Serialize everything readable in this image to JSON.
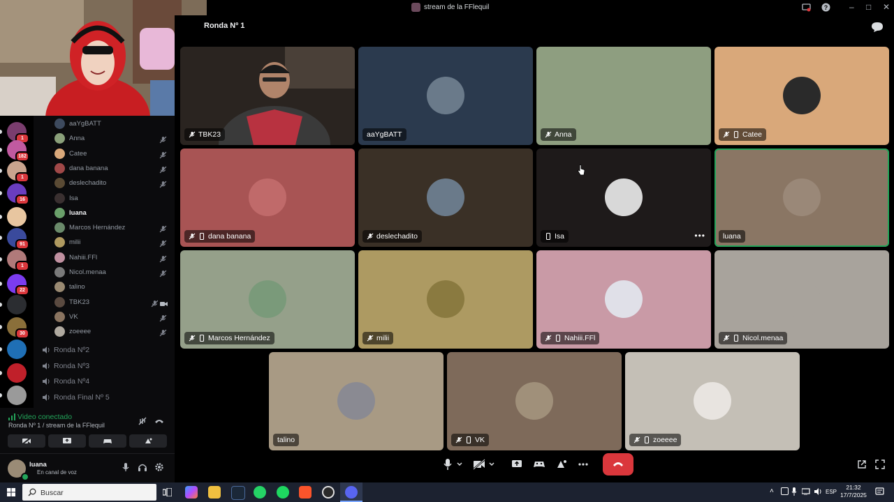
{
  "window": {
    "title": "stream de la FFlequil"
  },
  "stage": {
    "title": "Ronda Nº 1"
  },
  "servers": [
    {
      "badge": "1",
      "color": "#7a3d6e"
    },
    {
      "badge": "182",
      "color": "#c05aa0"
    },
    {
      "badge": "1",
      "color": "#c9a48e"
    },
    {
      "badge": "16",
      "color": "#6a3dbf"
    },
    {
      "badge": "",
      "color": "#e8c6a0"
    },
    {
      "badge": "91",
      "color": "#3a4a9c"
    },
    {
      "badge": "1",
      "color": "#b07a7a"
    },
    {
      "badge": "22",
      "color": "#7b3cf0"
    },
    {
      "badge": "",
      "color": "#2b2d31"
    },
    {
      "badge": "30",
      "color": "#8a6f3a"
    },
    {
      "badge": "",
      "color": "#1f6fb5"
    },
    {
      "badge": "",
      "color": "#c0202a"
    },
    {
      "badge": "",
      "color": "#9a9a9a"
    }
  ],
  "members": [
    {
      "name": "aaYgBATT",
      "muted": false,
      "video": false,
      "color": "#3d4a5e"
    },
    {
      "name": "Anna",
      "muted": true,
      "video": false,
      "color": "#8aa07a"
    },
    {
      "name": "Catee",
      "muted": true,
      "video": false,
      "color": "#d9a87a"
    },
    {
      "name": "dana banana",
      "muted": true,
      "video": false,
      "color": "#a04848"
    },
    {
      "name": "deslechadito",
      "muted": true,
      "video": false,
      "color": "#5a4a34"
    },
    {
      "name": "Isa",
      "muted": false,
      "video": false,
      "color": "#3a3030"
    },
    {
      "name": "luana",
      "muted": false,
      "video": false,
      "color": "#6aa06a"
    },
    {
      "name": "Marcos Hernández",
      "muted": true,
      "video": false,
      "color": "#6a8a6a"
    },
    {
      "name": "milii",
      "muted": true,
      "video": false,
      "color": "#b09a60"
    },
    {
      "name": "Nahiii.FFl",
      "muted": true,
      "video": false,
      "color": "#c090a0"
    },
    {
      "name": "Nicol.menaa",
      "muted": true,
      "video": false,
      "color": "#7a7a7a"
    },
    {
      "name": "talino",
      "muted": false,
      "video": false,
      "color": "#9a8a72"
    },
    {
      "name": "TBK23",
      "muted": true,
      "video": true,
      "color": "#5a4a40"
    },
    {
      "name": "VK",
      "muted": true,
      "video": false,
      "color": "#8a7460"
    },
    {
      "name": "zoeeee",
      "muted": true,
      "video": false,
      "color": "#b0aaa0"
    }
  ],
  "voice_channels": [
    {
      "name": "Ronda Nº2"
    },
    {
      "name": "Ronda Nº3"
    },
    {
      "name": "Ronda Nº4"
    },
    {
      "name": "Ronda Final Nº 5"
    }
  ],
  "voice_panel": {
    "status": "Video conectado",
    "channel": "Ronda Nº 1 / stream de la FFlequil"
  },
  "user": {
    "name": "luana",
    "status": "En canal de voz"
  },
  "tiles": [
    {
      "name": "TBK23",
      "bg": "#2a2420",
      "muted": true,
      "mobile": false,
      "video": true
    },
    {
      "name": "aaYgBATT",
      "bg": "#2b3a4e",
      "muted": false,
      "mobile": false,
      "avatar": "#6a7a8a"
    },
    {
      "name": "Anna",
      "bg": "#8e9e80",
      "muted": true,
      "mobile": false,
      "avatar": "#8e9e80"
    },
    {
      "name": "Catee",
      "bg": "#d9a87a",
      "muted": true,
      "mobile": true,
      "avatar": "#2a2a2a"
    },
    {
      "name": "dana banana",
      "bg": "#a85454",
      "muted": true,
      "mobile": true,
      "avatar": "#c06a6a"
    },
    {
      "name": "deslechadito",
      "bg": "#3a3026",
      "muted": true,
      "mobile": false,
      "avatar": "#6a7a8a"
    },
    {
      "name": "Isa",
      "bg": "#1e1a1a",
      "muted": false,
      "mobile": true,
      "avatar": "#d8d8d8",
      "more": true
    },
    {
      "name": "luana",
      "bg": "#8a7664",
      "muted": false,
      "mobile": false,
      "avatar": "#9a8878",
      "speaking": true
    },
    {
      "name": "Marcos Hernández",
      "bg": "#95a08a",
      "muted": true,
      "mobile": true,
      "avatar": "#7a9a7a"
    },
    {
      "name": "milii",
      "bg": "#ad9a62",
      "muted": true,
      "mobile": false,
      "avatar": "#8a7a40"
    },
    {
      "name": "Nahiii.FFl",
      "bg": "#c99aa6",
      "muted": true,
      "mobile": true,
      "avatar": "#e0e0e8"
    },
    {
      "name": "Nicol.menaa",
      "bg": "#a8a39c",
      "muted": true,
      "mobile": true,
      "avatar": "#a8a39c"
    },
    {
      "name": "talino",
      "bg": "#a89a84",
      "muted": false,
      "mobile": false,
      "avatar": "#8a8a92"
    },
    {
      "name": "VK",
      "bg": "#7e6a5a",
      "muted": true,
      "mobile": true,
      "avatar": "#a0907a"
    },
    {
      "name": "zoeeee",
      "bg": "#c4bfb6",
      "muted": true,
      "mobile": true,
      "avatar": "#e8e4e0"
    }
  ],
  "taskbar": {
    "search_placeholder": "Buscar",
    "lang": "ESP",
    "time": "21:32",
    "date": "17/7/2025"
  }
}
